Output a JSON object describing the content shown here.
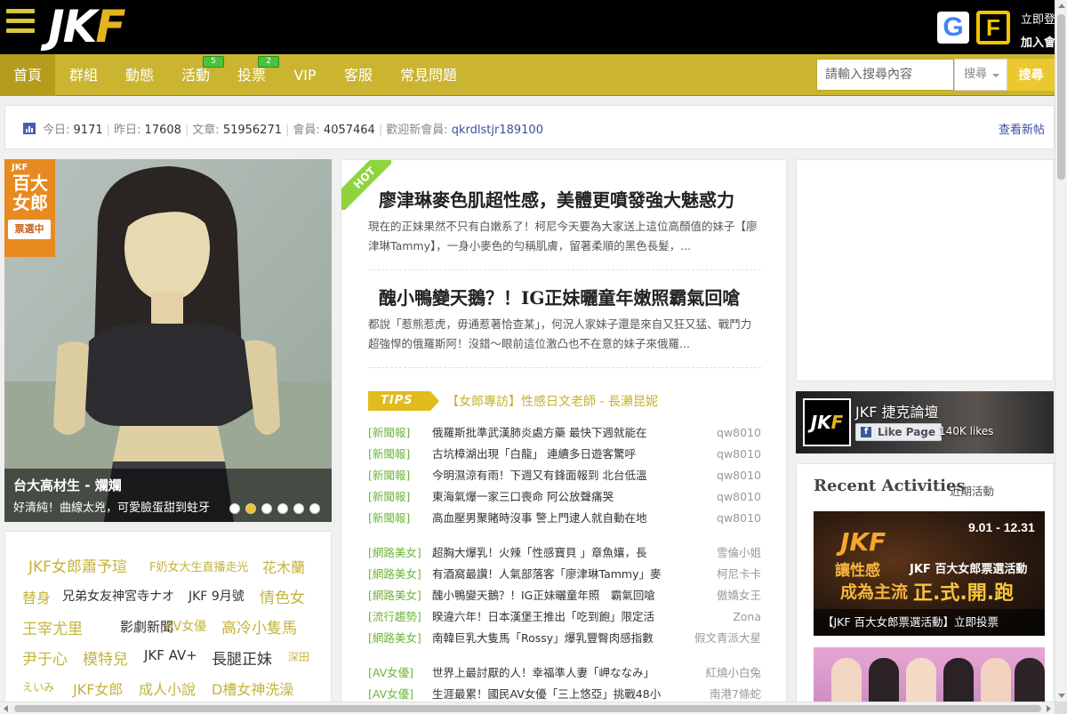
{
  "header": {
    "logo_main": "JK",
    "logo_accent": "F",
    "google_icon": "G",
    "facebook_icon": "F",
    "login_label": "立即登",
    "join_label": "加入會"
  },
  "nav": {
    "items": [
      {
        "label": "首頁",
        "badge": ""
      },
      {
        "label": "群組",
        "badge": ""
      },
      {
        "label": "動態",
        "badge": ""
      },
      {
        "label": "活動",
        "badge": "5"
      },
      {
        "label": "投票",
        "badge": "2"
      },
      {
        "label": "VIP",
        "badge": ""
      },
      {
        "label": "客服",
        "badge": ""
      },
      {
        "label": "常見問題",
        "badge": ""
      }
    ],
    "active_index": 0
  },
  "search": {
    "placeholder": "請輸入搜尋內容",
    "scope": "搜尋",
    "button": "搜尋"
  },
  "stats": {
    "today_label": "今日:",
    "today": "9171",
    "yesterday_label": "昨日:",
    "yesterday": "17608",
    "posts_label": "文章:",
    "posts": "51956271",
    "members_label": "會員:",
    "members": "4057464",
    "welcome_label": "歡迎新會員:",
    "new_member": "qkrdlstjr189100",
    "view_new": "查看新帖"
  },
  "hero": {
    "badge_brand": "JKF",
    "badge_title": "百大女郎",
    "badge_status": "票選中",
    "title": "台大高材生 - 斕斕",
    "subtitle": "好清純！曲線太兇，可愛臉蛋甜到蛀牙",
    "dot_count": 6,
    "active_dot": 1
  },
  "tags": [
    {
      "text": "JKF女郎蕭予瑄",
      "style": "y",
      "size": 17
    },
    {
      "text": "F奶女大生直播走光",
      "style": "y",
      "size": 13
    },
    {
      "text": "花木蘭",
      "style": "y",
      "size": 16
    },
    {
      "text": "替身",
      "style": "y",
      "size": 16
    },
    {
      "text": "兄弟女友神宮寺ナオ",
      "style": "d",
      "size": 14
    },
    {
      "text": "JKF 9月號",
      "style": "d",
      "size": 14
    },
    {
      "text": "情色女",
      "style": "y",
      "size": 17
    },
    {
      "text": "王宰尤里",
      "style": "y",
      "size": 17
    },
    {
      "text": "影劇新聞",
      "style": "d",
      "size": 15
    },
    {
      "text": "AV女優",
      "style": "y",
      "size": 14
    },
    {
      "text": "高冷小隻馬",
      "style": "y",
      "size": 17
    },
    {
      "text": "尹于心",
      "style": "y",
      "size": 17
    },
    {
      "text": "模特兒",
      "style": "y",
      "size": 17
    },
    {
      "text": "JKF AV+",
      "style": "d",
      "size": 15
    },
    {
      "text": "長腿正妹",
      "style": "d",
      "size": 17
    },
    {
      "text": "深田",
      "style": "y",
      "size": 12
    },
    {
      "text": "えいみ",
      "style": "y",
      "size": 12
    },
    {
      "text": "JKF女郎",
      "style": "y",
      "size": 16
    },
    {
      "text": "成人小說",
      "style": "y",
      "size": 16
    },
    {
      "text": "D槽女神洗澡",
      "style": "y",
      "size": 16
    }
  ],
  "featured": {
    "hot_label": "HOT",
    "articles": [
      {
        "title": "廖津琳麥色肌超性感，美體更噴發強大魅惑力",
        "excerpt": "現在的正妹果然不只有白嫩系了！柯尼今天要為大家送上這位高顏值的妹子【廖津琳Tammy】，一身小麥色的勻稱肌膚，留著柔順的黑色長髮，..."
      },
      {
        "title": "醜小鴨變天鵝？！IG正妹曬童年嫩照霸氣回嗆",
        "excerpt": "都說「惹熊惹虎，毋通惹著恰查某」，何況人家妹子還是來自又狂又猛、戰鬥力超強悍的俄羅斯阿！沒錯～眼前這位激凸也不在意的妹子來俄羅..."
      }
    ],
    "tips_label": "TIPS",
    "tips_text": "【女郎專訪】性感日文老師 - 長瀨昆妮"
  },
  "posts": [
    [
      {
        "cat": "[新聞報]",
        "title": "俄羅斯批準武漢肺炎處方藥 最快下週就能在",
        "author": "qw8010"
      },
      {
        "cat": "[新聞報]",
        "title": "古坑樟湖出現「白龍」 連續多日遊客驚呼",
        "author": "qw8010"
      },
      {
        "cat": "[新聞報]",
        "title": "今明濕涼有雨！下週又有鋒面報到 北台低溫",
        "author": "qw8010"
      },
      {
        "cat": "[新聞報]",
        "title": "東海氣爆一家三口喪命 阿公放聲痛哭",
        "author": "qw8010"
      },
      {
        "cat": "[新聞報]",
        "title": "高血壓男聚賭時沒事 警上門逮人就自動在地",
        "author": "qw8010"
      }
    ],
    [
      {
        "cat": "[網路美女]",
        "title": "超胸大爆乳！火辣「性感寶貝 」章魚孃，長",
        "author": "雪倫小姐"
      },
      {
        "cat": "[網路美女]",
        "title": "有酒窩最讚！人氣部落客「廖津琳Tammy」麥",
        "author": "柯尼卡卡"
      },
      {
        "cat": "[網路美女]",
        "title": "醜小鴨變天鵝？！IG正妹曬童年照　霸氣回嗆",
        "author": "傲嬌女王"
      },
      {
        "cat": "[流行趨勢]",
        "title": "睽違六年！日本漢堡王推出「吃到飽」限定活",
        "author": "Zona"
      },
      {
        "cat": "[網路美女]",
        "title": "南韓巨乳大隻馬「Rossy」爆乳豐臀肉感指數",
        "author": "假文青派大星"
      }
    ],
    [
      {
        "cat": "[AV女優]",
        "title": "世界上最討厭的人！幸福準人妻「岬ななみ」",
        "author": "紅燒小白兔"
      },
      {
        "cat": "[AV女優]",
        "title": "生涯最累！國民AV女優「三上悠亞」挑戰48小",
        "author": "南港7條蛇"
      }
    ]
  ],
  "sidebar": {
    "fb_name": "JKF 捷克論壇",
    "fb_logo_main": "JK",
    "fb_logo_accent": "F",
    "fb_like_icon": "f",
    "fb_like": "Like Page",
    "fb_likes": "140K likes",
    "ra_title": "Recent Activities",
    "ra_sub": "近期活動",
    "banner_brand": "JKF",
    "banner_date": "9.01 - 12.31",
    "banner_line1": "讓性感",
    "banner_line1b": "JKF 百大女郎票選活動",
    "banner_line2": "成為主流",
    "banner_line2b": "正.式.開.跑",
    "banner_caption": "【JKF 百大女郎票選活動】立即投票"
  }
}
